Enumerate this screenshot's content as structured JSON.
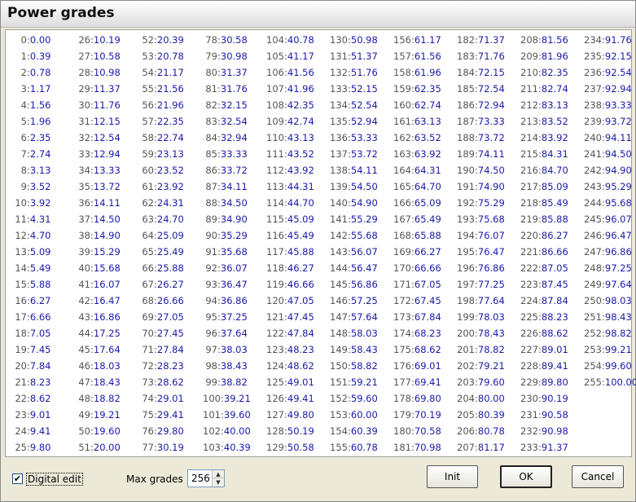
{
  "window": {
    "title": "Power grades"
  },
  "grades": [
    "0.00",
    "0.39",
    "0.78",
    "1.17",
    "1.56",
    "1.96",
    "2.35",
    "2.74",
    "3.13",
    "3.52",
    "3.92",
    "4.31",
    "4.70",
    "5.09",
    "5.49",
    "5.88",
    "6.27",
    "6.66",
    "7.05",
    "7.45",
    "7.84",
    "8.23",
    "8.62",
    "9.01",
    "9.41",
    "9.80",
    "10.19",
    "10.58",
    "10.98",
    "11.37",
    "11.76",
    "12.15",
    "12.54",
    "12.94",
    "13.33",
    "13.72",
    "14.11",
    "14.50",
    "14.90",
    "15.29",
    "15.68",
    "16.07",
    "16.47",
    "16.86",
    "17.25",
    "17.64",
    "18.03",
    "18.43",
    "18.82",
    "19.21",
    "19.60",
    "20.00",
    "20.39",
    "20.78",
    "21.17",
    "21.56",
    "21.96",
    "22.35",
    "22.74",
    "23.13",
    "23.52",
    "23.92",
    "24.31",
    "24.70",
    "25.09",
    "25.49",
    "25.88",
    "26.27",
    "26.66",
    "27.05",
    "27.45",
    "27.84",
    "28.23",
    "28.62",
    "29.01",
    "29.41",
    "29.80",
    "30.19",
    "30.58",
    "30.98",
    "31.37",
    "31.76",
    "32.15",
    "32.54",
    "32.94",
    "33.33",
    "33.72",
    "34.11",
    "34.50",
    "34.90",
    "35.29",
    "35.68",
    "36.07",
    "36.47",
    "36.86",
    "37.25",
    "37.64",
    "38.03",
    "38.43",
    "38.82",
    "39.21",
    "39.60",
    "40.00",
    "40.39",
    "40.78",
    "41.17",
    "41.56",
    "41.96",
    "42.35",
    "42.74",
    "43.13",
    "43.52",
    "43.92",
    "44.31",
    "44.70",
    "45.09",
    "45.49",
    "45.88",
    "46.27",
    "46.66",
    "47.05",
    "47.45",
    "47.84",
    "48.23",
    "48.62",
    "49.01",
    "49.41",
    "49.80",
    "50.19",
    "50.58",
    "50.98",
    "51.37",
    "51.76",
    "52.15",
    "52.54",
    "52.94",
    "53.33",
    "53.72",
    "54.11",
    "54.50",
    "54.90",
    "55.29",
    "55.68",
    "56.07",
    "56.47",
    "56.86",
    "57.25",
    "57.64",
    "58.03",
    "58.43",
    "58.82",
    "59.21",
    "59.60",
    "60.00",
    "60.39",
    "60.78",
    "61.17",
    "61.56",
    "61.96",
    "62.35",
    "62.74",
    "63.13",
    "63.52",
    "63.92",
    "64.31",
    "64.70",
    "65.09",
    "65.49",
    "65.88",
    "66.27",
    "66.66",
    "67.05",
    "67.45",
    "67.84",
    "68.23",
    "68.62",
    "69.01",
    "69.41",
    "69.80",
    "70.19",
    "70.58",
    "70.98",
    "71.37",
    "71.76",
    "72.15",
    "72.54",
    "72.94",
    "73.33",
    "73.72",
    "74.11",
    "74.50",
    "74.90",
    "75.29",
    "75.68",
    "76.07",
    "76.47",
    "76.86",
    "77.25",
    "77.64",
    "78.03",
    "78.43",
    "78.82",
    "79.21",
    "79.60",
    "80.00",
    "80.39",
    "80.78",
    "81.17",
    "81.56",
    "81.96",
    "82.35",
    "82.74",
    "83.13",
    "83.52",
    "83.92",
    "84.31",
    "84.70",
    "85.09",
    "85.49",
    "85.88",
    "86.27",
    "86.66",
    "87.05",
    "87.45",
    "87.84",
    "88.23",
    "88.62",
    "89.01",
    "89.41",
    "89.80",
    "90.19",
    "90.58",
    "90.98",
    "91.37",
    "91.76",
    "92.15",
    "92.54",
    "92.94",
    "93.33",
    "93.72",
    "94.11",
    "94.50",
    "94.90",
    "95.29",
    "95.68",
    "96.07",
    "96.47",
    "96.86",
    "97.25",
    "97.64",
    "98.03",
    "98.43",
    "98.82",
    "99.21",
    "99.60",
    "100.00"
  ],
  "controls": {
    "digital_edit_label": "Digital edit",
    "digital_edit_checked": true,
    "max_grades_label": "Max grades",
    "max_grades_value": "256",
    "init_label": "Init",
    "ok_label": "OK",
    "cancel_label": "Cancel"
  },
  "colors": {
    "value_text": "#1a1aa8",
    "index_text": "#555555"
  }
}
